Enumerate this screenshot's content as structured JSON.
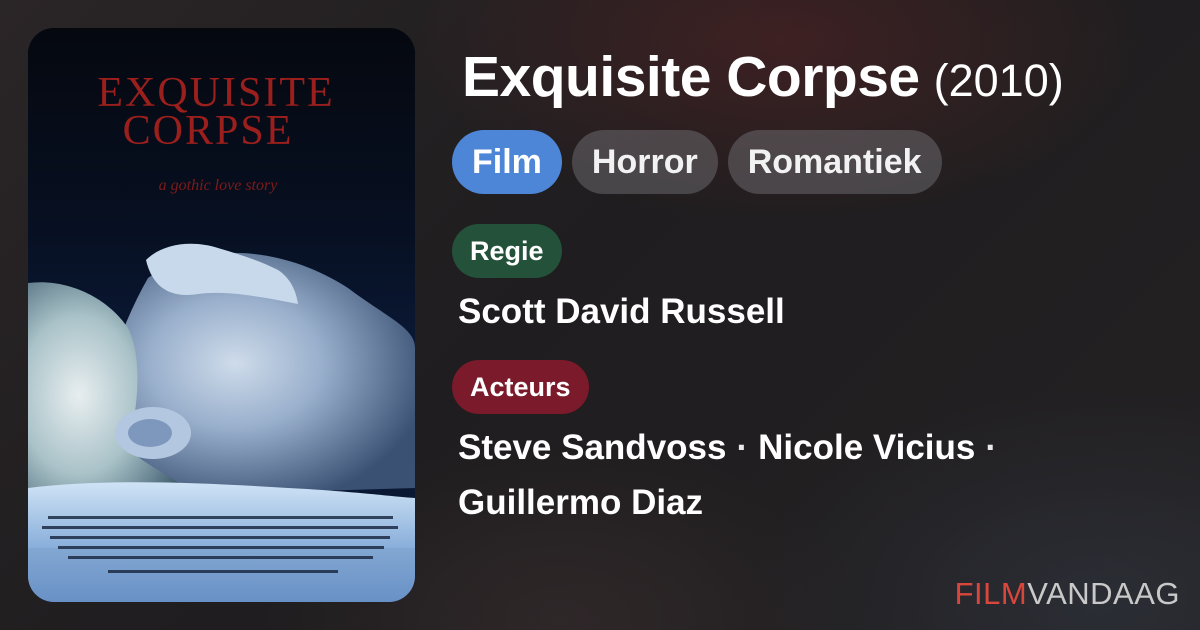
{
  "movie": {
    "title": "Exquisite Corpse",
    "year": "(2010)"
  },
  "poster": {
    "title_line1": "EXQUISITE",
    "title_line2": "CORPSE",
    "tagline": "a gothic love story"
  },
  "genres": [
    {
      "label": "Film",
      "active": true
    },
    {
      "label": "Horror",
      "active": false
    },
    {
      "label": "Romantiek",
      "active": false
    }
  ],
  "credits": {
    "director_label": "Regie",
    "director": "Scott David Russell",
    "cast_label": "Acteurs",
    "cast": [
      "Steve Sandvoss",
      "Nicole Vicius",
      "Guillermo Diaz"
    ],
    "separator": "·"
  },
  "brand": {
    "part1": "FILM",
    "part2": "VANDAAG"
  },
  "colors": {
    "active_genre": "#4d86d6",
    "director_badge": "#23513a",
    "cast_badge": "#7a1a2a",
    "brand_accent": "#d9473c"
  }
}
